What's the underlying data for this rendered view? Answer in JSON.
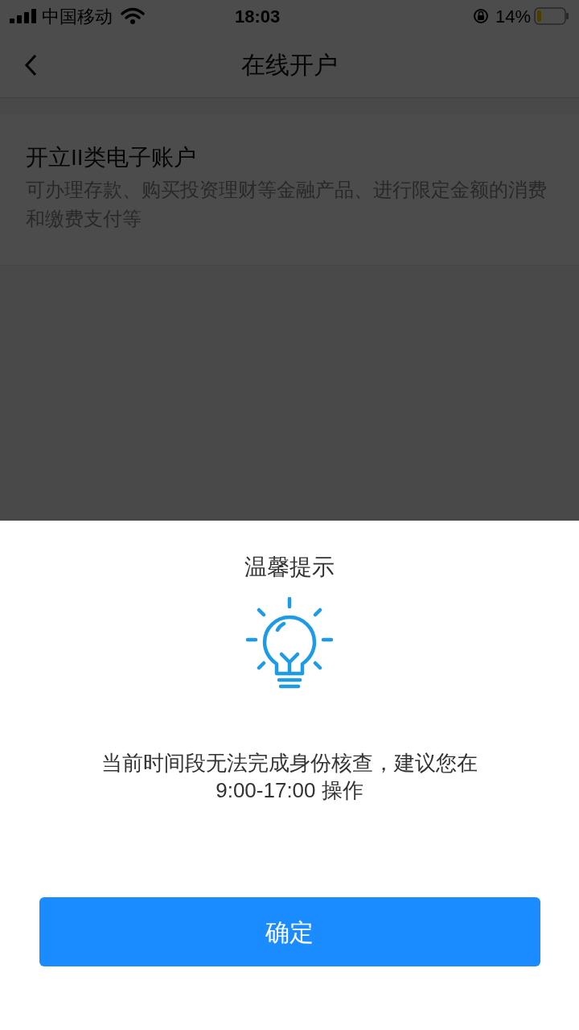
{
  "status_bar": {
    "carrier": "中国移动",
    "time": "18:03",
    "battery": "14%"
  },
  "nav": {
    "title": "在线开户"
  },
  "account_card": {
    "title": "开立II类电子账户",
    "description": "可办理存款、购买投资理财等金融产品、进行限定金额的消费和缴费支付等"
  },
  "dialog": {
    "title": "温馨提示",
    "message": "当前时间段无法完成身份核查，建议您在",
    "message_line_2": "9:00-17:00 操作",
    "button": "确定"
  }
}
